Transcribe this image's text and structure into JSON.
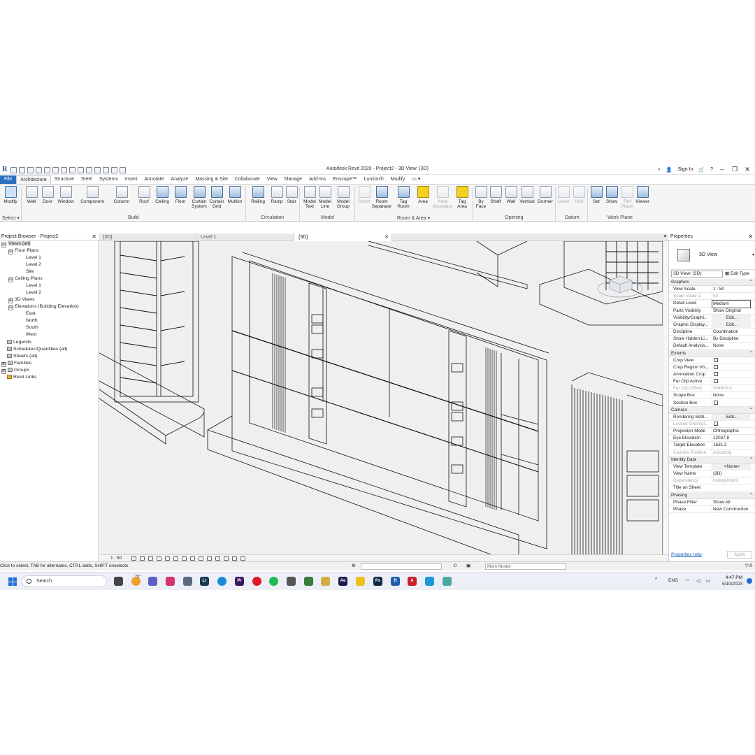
{
  "window": {
    "title": "Autodesk Revit 2020 - Project2 - 3D View: {3D}",
    "sign_in": "Sign In"
  },
  "ribbon_tabs": [
    "File",
    "Architecture",
    "Structure",
    "Steel",
    "Systems",
    "Insert",
    "Annotate",
    "Analyze",
    "Massing & Site",
    "Collaborate",
    "View",
    "Manage",
    "Add-Ins",
    "Enscape™",
    "Lumion®",
    "Modify"
  ],
  "ribbon": {
    "select": {
      "modify": "Modify",
      "select": "Select ▾"
    },
    "build": {
      "label": "Build",
      "wall": "Wall",
      "door": "Door",
      "window": "Window",
      "component": "Component",
      "column": "Column",
      "roof": "Roof",
      "ceiling": "Ceiling",
      "floor": "Floor",
      "curtain_system_1": "Curtain",
      "curtain_system_2": "System",
      "curtain_grid_1": "Curtain",
      "curtain_grid_2": "Grid",
      "mullion": "Mullion"
    },
    "circulation": {
      "label": "Circulation",
      "railing": "Railing",
      "ramp": "Ramp",
      "stair": "Stair"
    },
    "model": {
      "label": "Model",
      "model_text_1": "Model",
      "model_text_2": "Text",
      "model_line_1": "Model",
      "model_line_2": "Line",
      "model_group_1": "Model",
      "model_group_2": "Group"
    },
    "room_area": {
      "label": "Room & Area ▾",
      "room": "Room",
      "room_sep_1": "Room",
      "room_sep_2": "Separator",
      "tag_room_1": "Tag",
      "tag_room_2": "Room",
      "area": "Area",
      "area_boundary_1": "Area",
      "area_boundary_2": "Boundary",
      "tag_area_1": "Tag",
      "tag_area_2": "Area"
    },
    "opening": {
      "label": "Opening",
      "by_face_1": "By",
      "by_face_2": "Face",
      "shaft": "Shaft",
      "wall": "Wall",
      "vertical": "Vertical",
      "dormer": "Dormer"
    },
    "datum": {
      "label": "Datum",
      "level": "Level",
      "grid": "Grid"
    },
    "work_plane": {
      "label": "Work Plane",
      "set": "Set",
      "show": "Show",
      "ref_plane_1": "Ref",
      "ref_plane_2": "Plane",
      "viewer": "Viewer"
    }
  },
  "project_browser": {
    "title": "Project Browser - Project2",
    "nodes": [
      {
        "label": "Views (all)",
        "toggle": "⊟"
      },
      {
        "label": "Floor Plans",
        "toggle": "⊟"
      },
      {
        "label": "Level 1"
      },
      {
        "label": "Level 2"
      },
      {
        "label": "Site"
      },
      {
        "label": "Ceiling Plans",
        "toggle": "⊟"
      },
      {
        "label": "Level 1"
      },
      {
        "label": "Level 2"
      },
      {
        "label": "3D Views",
        "toggle": "⊞"
      },
      {
        "label": "Elevations (Building Elevation)",
        "toggle": "⊟"
      },
      {
        "label": "East"
      },
      {
        "label": "North"
      },
      {
        "label": "South"
      },
      {
        "label": "West"
      },
      {
        "label": "Legends"
      },
      {
        "label": "Schedules/Quantities (all)"
      },
      {
        "label": "Sheets (all)"
      },
      {
        "label": "Families",
        "toggle": "⊞"
      },
      {
        "label": "Groups",
        "toggle": "⊞"
      },
      {
        "label": "Revit Links"
      }
    ]
  },
  "view_tabs": [
    "{3D}",
    "Level 1",
    "{3D}"
  ],
  "view_control": {
    "scale": "1 : 50"
  },
  "properties": {
    "title": "Properties",
    "type_name": "3D View",
    "selector": "3D View: {3D}",
    "edit_type": "Edit Type",
    "groups": [
      {
        "name": "Graphics",
        "rows": [
          {
            "k": "View Scale",
            "v": "1 : 50"
          },
          {
            "k": "Scale Value    1:",
            "v": "50",
            "dim": true
          },
          {
            "k": "Detail Level",
            "v": "Medium",
            "box": true
          },
          {
            "k": "Parts Visibility",
            "v": "Show Original"
          },
          {
            "k": "Visibility/Graphi...",
            "v": "Edit...",
            "btn": true
          },
          {
            "k": "Graphic Display...",
            "v": "Edit...",
            "btn": true
          },
          {
            "k": "Discipline",
            "v": "Coordination"
          },
          {
            "k": "Show Hidden Li...",
            "v": "By Discipline"
          },
          {
            "k": "Default Analysis...",
            "v": "None"
          }
        ]
      },
      {
        "name": "Extents",
        "rows": [
          {
            "k": "Crop View",
            "cb": true
          },
          {
            "k": "Crop Region Vis...",
            "cb": true
          },
          {
            "k": "Annotation Crop",
            "cb": true
          },
          {
            "k": "Far Clip Active",
            "cb": true
          },
          {
            "k": "Far Clip Offset",
            "v": "304800.0",
            "dim": true
          },
          {
            "k": "Scope Box",
            "v": "None"
          },
          {
            "k": "Section Box",
            "cb": true
          }
        ]
      },
      {
        "name": "Camera",
        "rows": [
          {
            "k": "Rendering Setti...",
            "v": "Edit...",
            "btn": true
          },
          {
            "k": "Locked Orientat...",
            "cb": true,
            "dim": true
          },
          {
            "k": "Projection Mode",
            "v": "Orthographic"
          },
          {
            "k": "Eye Elevation",
            "v": "12037.8"
          },
          {
            "k": "Target Elevation",
            "v": "1631.2"
          },
          {
            "k": "Camera Position",
            "v": "Adjusting",
            "dim": true
          }
        ]
      },
      {
        "name": "Identity Data",
        "rows": [
          {
            "k": "View Template",
            "v": "<None>",
            "btn": true
          },
          {
            "k": "View Name",
            "v": "{3D}"
          },
          {
            "k": "Dependency",
            "v": "Independent",
            "dim": true
          },
          {
            "k": "Title on Sheet",
            "v": ""
          }
        ]
      },
      {
        "name": "Phasing",
        "rows": [
          {
            "k": "Phase Filter",
            "v": "Show All"
          },
          {
            "k": "Phase",
            "v": "New Construction"
          }
        ]
      }
    ],
    "help": "Properties help",
    "apply": "Apply"
  },
  "status": {
    "message": "Click to select, TAB for alternates, CTRL adds, SHIFT unselects.",
    "selection": ":0",
    "model": "Main Model",
    "filter": ":0"
  },
  "taskbar": {
    "search": "Search",
    "weather": "75°",
    "lang": "ENG",
    "time": "4:47 PM",
    "date": "5/10/2023",
    "apps": [
      {
        "name": "Lr",
        "color": "#173a56"
      },
      {
        "name": "Pr",
        "color": "#3a1a5c"
      },
      {
        "name": "Ae",
        "color": "#1b1a4f"
      },
      {
        "name": "Ps",
        "color": "#0d2a45"
      },
      {
        "name": "R",
        "color": "#1f5ea8"
      },
      {
        "name": "A",
        "color": "#c8202a"
      }
    ]
  }
}
